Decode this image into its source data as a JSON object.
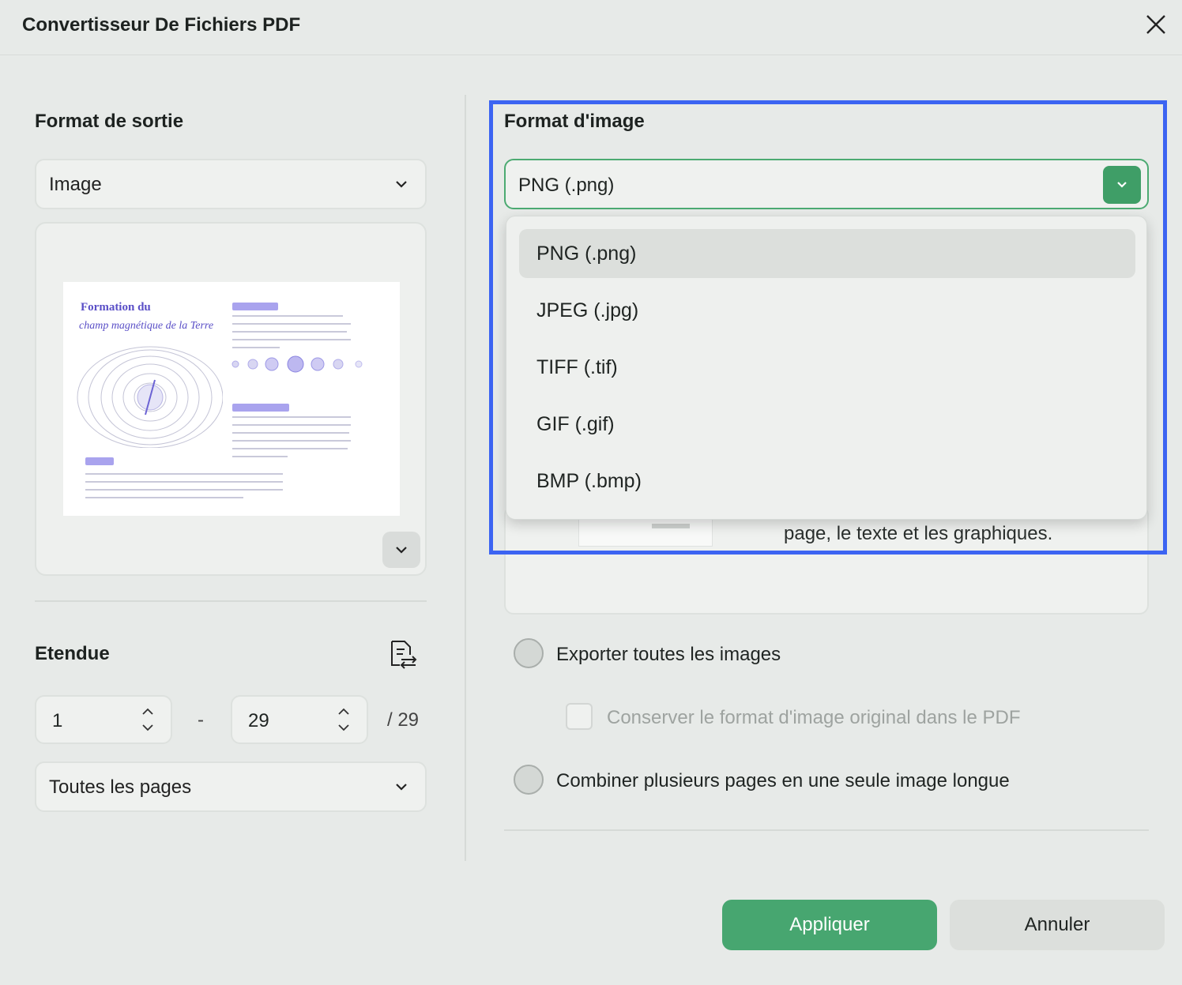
{
  "window": {
    "title": "Convertisseur De Fichiers PDF"
  },
  "left": {
    "output_title": "Format de sortie",
    "output_select": "Image",
    "preview": {
      "doc_title_line1": "Formation du",
      "doc_title_line2": "champ magnétique de la Terre"
    },
    "range_title": "Etendue",
    "range_from": "1",
    "range_sep": "-",
    "range_to": "29",
    "range_total": "/ 29",
    "pages_select": "Toutes les pages"
  },
  "right": {
    "image_format_title": "Format d'image",
    "image_format_value": "PNG (.png)",
    "dropdown_options": [
      "PNG (.png)",
      "JPEG (.jpg)",
      "TIFF (.tif)",
      "GIF (.gif)",
      "BMP (.bmp)"
    ],
    "hidden_desc": "page, le texte et les graphiques.",
    "export_all_label": "Exporter toutes les images",
    "keep_format_label": "Conserver le format d'image original dans le PDF",
    "combine_label": "Combiner plusieurs pages en une seule image longue"
  },
  "footer": {
    "apply": "Appliquer",
    "cancel": "Annuler"
  },
  "colors": {
    "accent_green": "#47a670",
    "highlight_blue": "#3c64f2",
    "preview_purple": "#5a4fc7"
  }
}
